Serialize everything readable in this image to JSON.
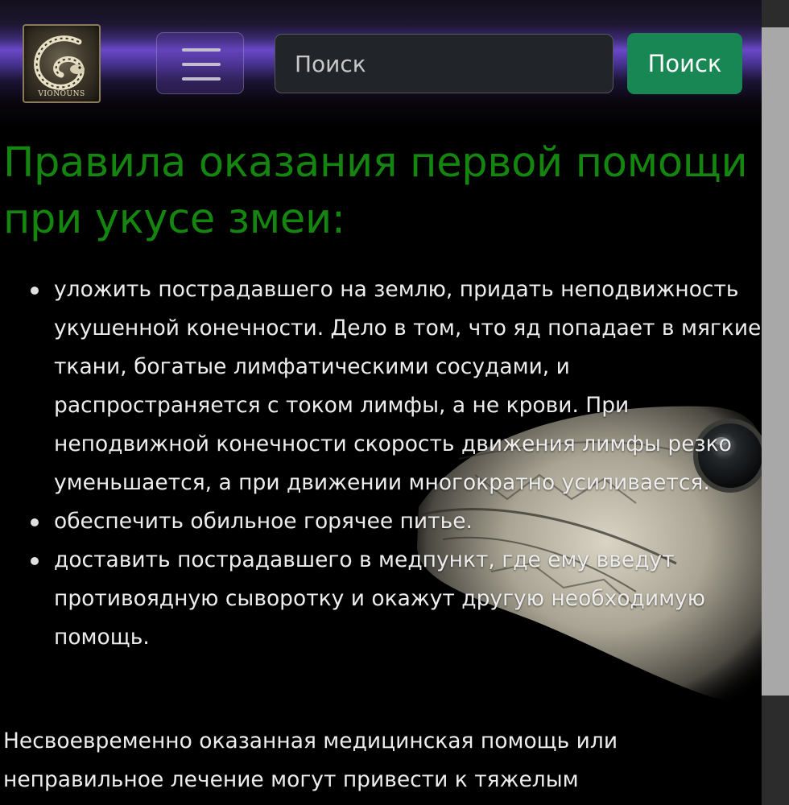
{
  "brand": {
    "logo_text": "VIONOUNS"
  },
  "navbar": {
    "toggler_icon": "hamburger-icon",
    "search": {
      "placeholder": "Поиск",
      "value": "",
      "button_label": "Поиск"
    }
  },
  "article": {
    "heading": "Правила оказания первой помощи при укусе змеи:",
    "bullets": [
      "уложить пострадавшего на землю, придать неподвижность укушенной конечности. Дело в том, что яд попадает в мягкие ткани, богатые лимфатическими сосудами, и распространяется с током лимфы, а не крови. При неподвижной конечности скорость движения лимфы резко уменьшается, а при движении многократно усиливается.",
      "обеспечить обильное горячее питье.",
      "доставить пострадавшего в медпункт, где ему введут противоядную сыворотку и окажут другую необходимую помощь."
    ],
    "paragraph": "Несвоевременно оказанная медицинская помощь или неправильное лечение могут привести к тяжелым"
  },
  "colors": {
    "heading": "#14860f",
    "search_button": "#198754",
    "navbar_accent": "#6a48c8",
    "background": "#000000"
  }
}
